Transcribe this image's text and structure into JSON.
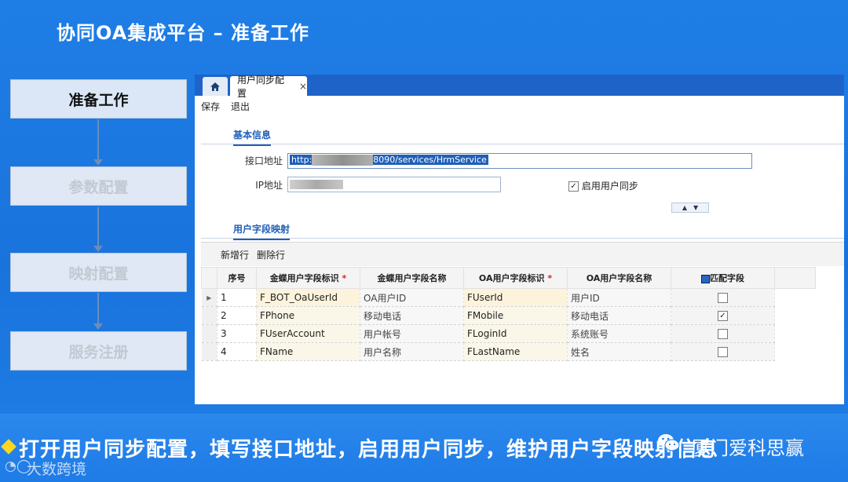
{
  "slide": {
    "title": "协同OA集成平台 – 准备工作"
  },
  "steps": [
    {
      "label": "准备工作",
      "active": true
    },
    {
      "label": "参数配置",
      "active": false
    },
    {
      "label": "映射配置",
      "active": false
    },
    {
      "label": "服务注册",
      "active": false
    }
  ],
  "app": {
    "tabs": {
      "home_icon": "home-icon",
      "active_tab": "用户同步配置",
      "close": "×"
    },
    "toolbar": {
      "save": "保存",
      "exit": "退出"
    },
    "basic": {
      "section": "基本信息",
      "endpoint_label": "接口地址",
      "endpoint_prefix": "http:",
      "endpoint_suffix": "8090/services/HrmService",
      "ip_label": "IP地址",
      "enable_sync_label": "启用用户同步",
      "enable_sync_checked": true
    },
    "mapping": {
      "section": "用户字段映射",
      "add_row": "新增行",
      "delete_row": "删除行",
      "columns": [
        "序号",
        "金蝶用户字段标识",
        "金蝶用户字段名称",
        "OA用户字段标识",
        "OA用户字段名称",
        "匹配字段"
      ],
      "rows": [
        {
          "no": "1",
          "k_id": "F_BOT_OaUserId",
          "k_name": "OA用户ID",
          "oa_id": "FUserId",
          "oa_name": "用户ID",
          "match": false
        },
        {
          "no": "2",
          "k_id": "FPhone",
          "k_name": "移动电话",
          "oa_id": "FMobile",
          "oa_name": "移动电话",
          "match": true
        },
        {
          "no": "3",
          "k_id": "FUserAccount",
          "k_name": "用户帐号",
          "oa_id": "FLoginId",
          "oa_name": "系统账号",
          "match": false
        },
        {
          "no": "4",
          "k_id": "FName",
          "k_name": "用户名称",
          "oa_id": "FLastName",
          "oa_name": "姓名",
          "match": false
        }
      ]
    }
  },
  "banner": {
    "text": "打开用户同步配置，填写接口地址，启用用户同步，维护用户字段映射信息",
    "watermark_right": "厦门爱科思赢",
    "watermark_left": "大数跨境"
  },
  "colors": {
    "accent": "#1d63c8",
    "background": "#1a73dd",
    "bullet": "#ffd61f"
  }
}
